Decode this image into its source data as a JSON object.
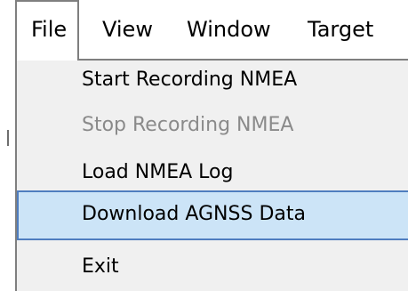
{
  "menubar": {
    "items": [
      {
        "label": "File"
      },
      {
        "label": "View"
      },
      {
        "label": "Window"
      },
      {
        "label": "Target"
      }
    ]
  },
  "file_menu": {
    "items": [
      {
        "label": "Start Recording NMEA",
        "enabled": true,
        "selected": false
      },
      {
        "label": "Stop Recording NMEA",
        "enabled": false,
        "selected": false
      },
      {
        "label": "Load NMEA Log",
        "enabled": true,
        "selected": false
      },
      {
        "label": "Download AGNSS Data",
        "enabled": true,
        "selected": true
      },
      {
        "label": "Exit",
        "enabled": true,
        "selected": false
      }
    ]
  },
  "colors": {
    "menu_background": "#f0f0f0",
    "highlight_fill": "#cce4f7",
    "highlight_border": "#4f7dbf",
    "disabled_text": "#8a8a8a",
    "border": "#7f7f7f"
  }
}
